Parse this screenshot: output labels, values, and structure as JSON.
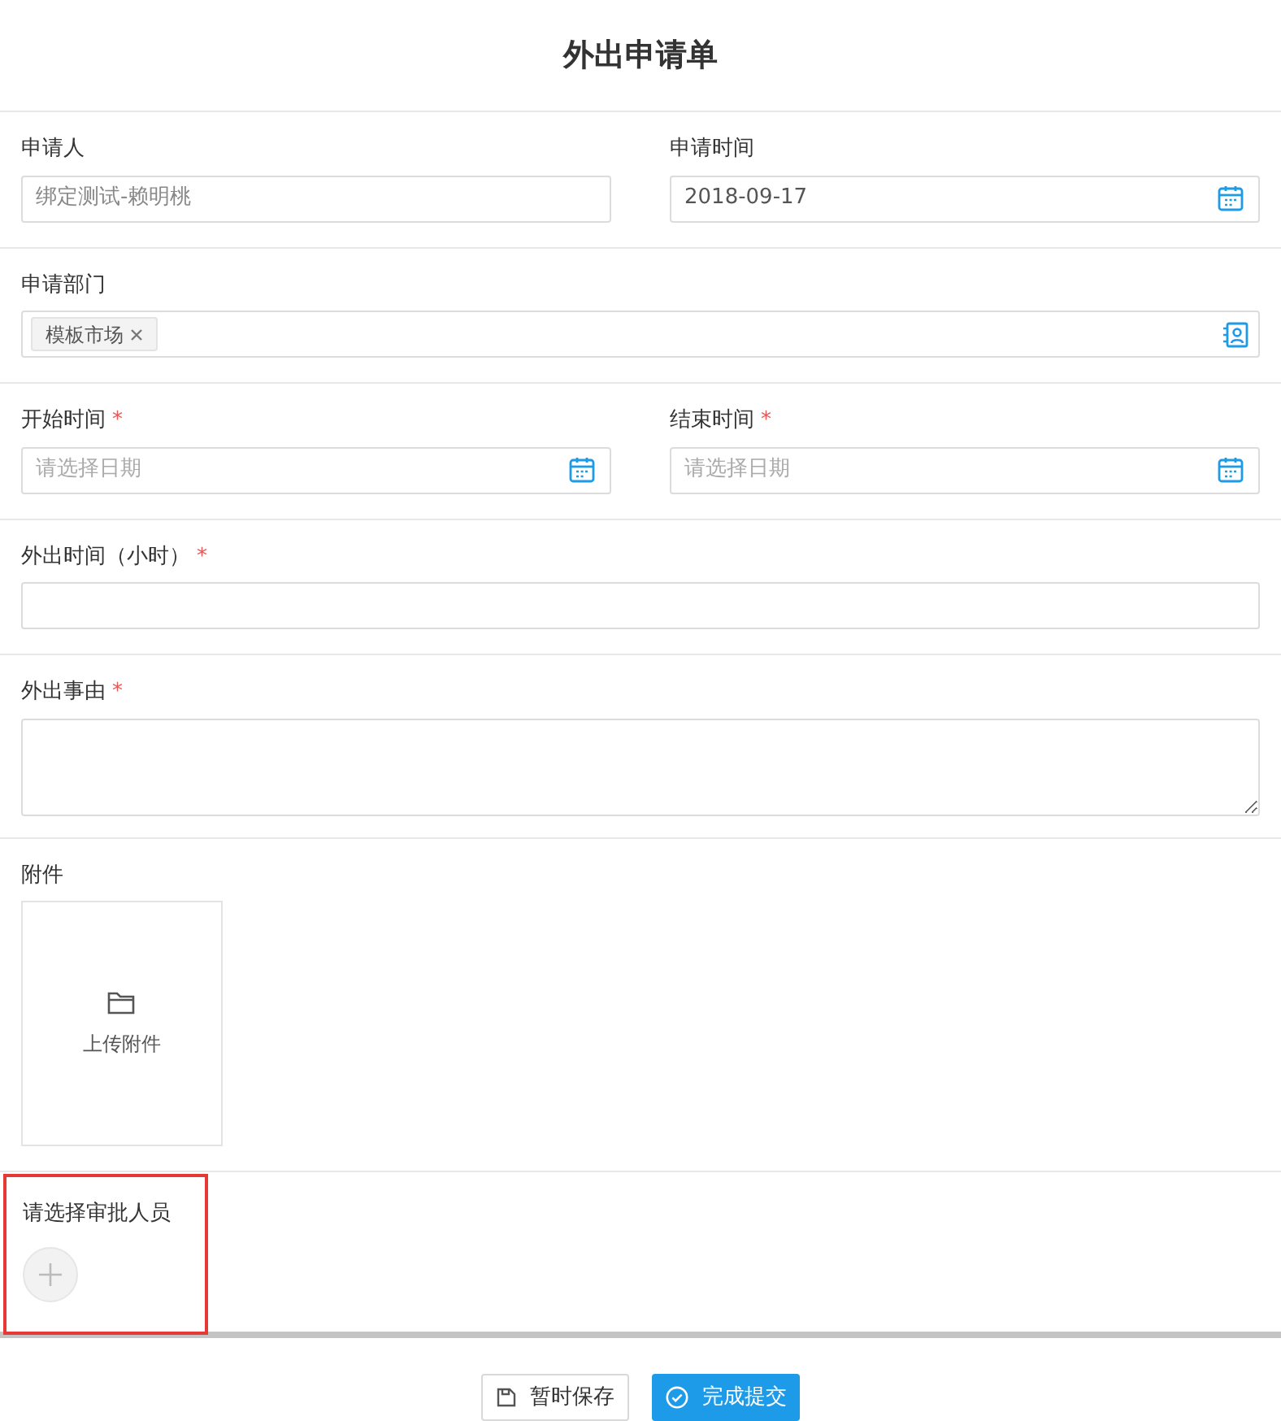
{
  "title": "外出申请单",
  "rows": [
    {
      "fields": [
        {
          "kind": "text",
          "label": "申请人",
          "value": "绑定测试-赖明桃",
          "disabled": true
        },
        {
          "kind": "date",
          "label": "申请时间",
          "value": "2018-09-17"
        }
      ]
    },
    {
      "fields": [
        {
          "kind": "tags",
          "label": "申请部门",
          "tags": [
            "模板市场"
          ]
        }
      ]
    },
    {
      "fields": [
        {
          "kind": "date",
          "label": "开始时间",
          "required_mark": "*",
          "placeholder": "请选择日期"
        },
        {
          "kind": "date",
          "label": "结束时间",
          "required_mark": "*",
          "placeholder": "请选择日期"
        }
      ]
    },
    {
      "fields": [
        {
          "kind": "text",
          "label": "外出时间（小时）",
          "required_mark": "*"
        }
      ]
    },
    {
      "fields": [
        {
          "kind": "textarea",
          "label": "外出事由",
          "required_mark": "*"
        }
      ]
    },
    {
      "fields": [
        {
          "kind": "upload",
          "label": "附件",
          "button": "上传附件"
        }
      ]
    }
  ],
  "approver": {
    "label": "请选择审批人员",
    "highlighted": true
  },
  "buttons": [
    {
      "kind": "secondary",
      "label": "暂时保存"
    },
    {
      "kind": "primary",
      "label": "完成提交"
    }
  ]
}
